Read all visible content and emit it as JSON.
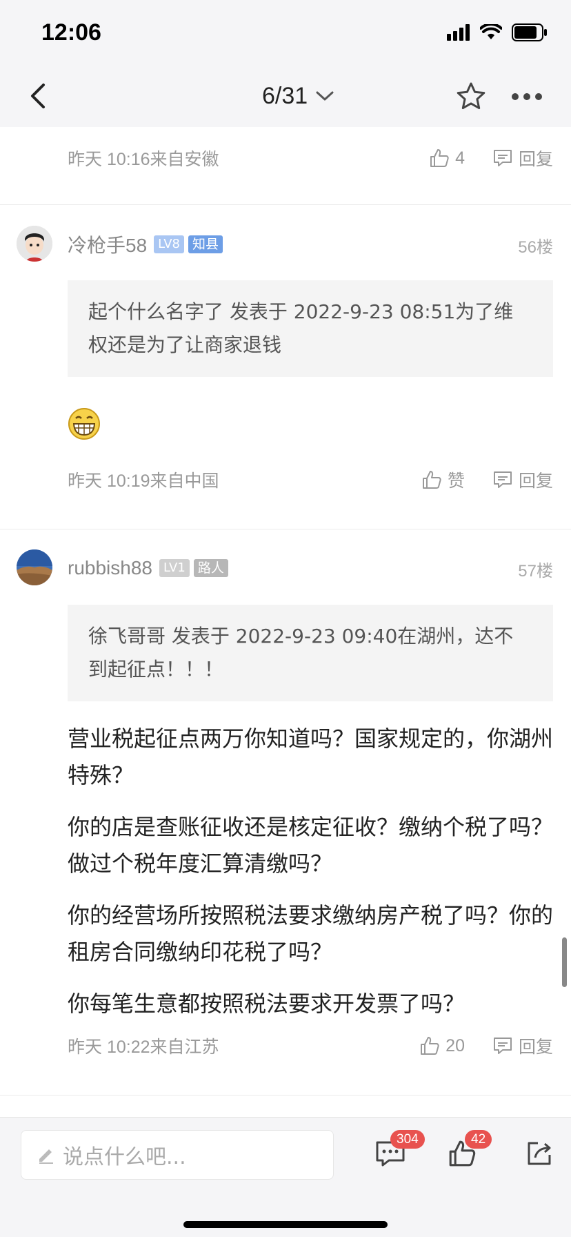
{
  "status_bar": {
    "time": "12:06"
  },
  "nav": {
    "page_indicator": "6/31"
  },
  "comments": [
    {
      "time_location": "昨天 10:16来自安徽",
      "like_label": "4",
      "reply_label": "回复"
    },
    {
      "username": "冷枪手58",
      "level": "LV8",
      "title": "知县",
      "floor": "56楼",
      "quote": "起个什么名字了 发表于 2022-9-23 08:51为了维权还是为了让商家退钱",
      "time_location": "昨天 10:19来自中国",
      "like_label": "赞",
      "reply_label": "回复"
    },
    {
      "username": "rubbish88",
      "level": "LV1",
      "title": "路人",
      "floor": "57楼",
      "quote": "徐飞哥哥 发表于 2022-9-23 09:40在湖州，达不到起征点！！！",
      "body": [
        "营业税起征点两万你知道吗？国家规定的，你湖州特殊？",
        "你的店是查账征收还是核定征收？缴纳个税了吗？做过个税年度汇算清缴吗？",
        "你的经营场所按照税法要求缴纳房产税了吗？你的租房合同缴纳印花税了吗？",
        "你每笔生意都按照税法要求开发票了吗？"
      ],
      "time_location": "昨天 10:22来自江苏",
      "like_label": "20",
      "reply_label": "回复"
    }
  ],
  "bottom_bar": {
    "input_placeholder": "说点什么吧...",
    "comment_count": "304",
    "like_count": "42"
  },
  "colors": {
    "accent_badge": "#e8524f",
    "level_badge": "#a9c6f3",
    "title_badge": "#6d9ee6"
  }
}
